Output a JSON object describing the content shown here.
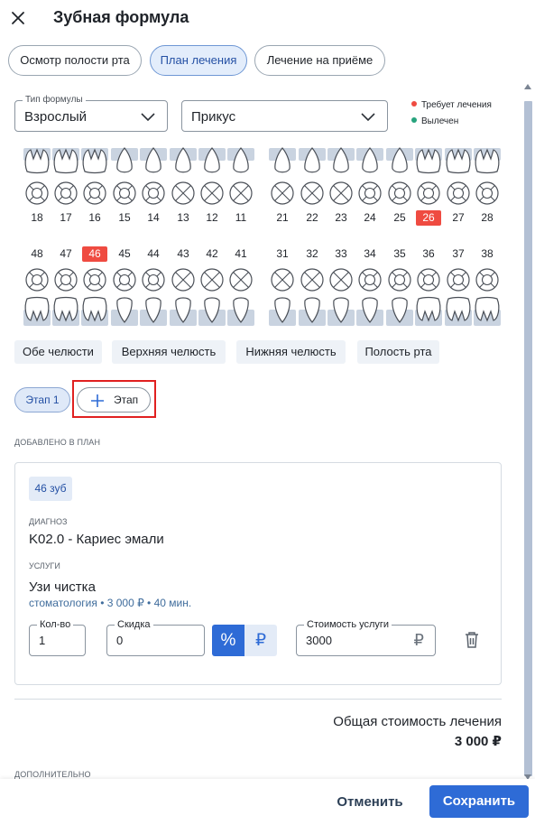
{
  "header": {
    "title": "Зубная формула"
  },
  "tabs": [
    {
      "label": "Осмотр полости рта",
      "active": false
    },
    {
      "label": "План лечения",
      "active": true
    },
    {
      "label": "Лечение на приёме",
      "active": false
    }
  ],
  "formula_type": {
    "label": "Тип формулы",
    "value": "Взрослый"
  },
  "bite": {
    "value": "Прикус"
  },
  "legend": {
    "needs_treatment": {
      "label": "Требует лечения",
      "color": "#ef4b41"
    },
    "extracted": {
      "label": "Вылечен",
      "color": "#27a37d"
    }
  },
  "upper_teeth": [
    "18",
    "17",
    "16",
    "15",
    "14",
    "13",
    "12",
    "11",
    "21",
    "22",
    "23",
    "24",
    "25",
    "26",
    "27",
    "28"
  ],
  "lower_teeth": [
    "48",
    "47",
    "46",
    "45",
    "44",
    "43",
    "42",
    "41",
    "31",
    "32",
    "33",
    "34",
    "35",
    "36",
    "37",
    "38"
  ],
  "selected_teeth": [
    "26",
    "46"
  ],
  "jaw_buttons": [
    "Обе челюсти",
    "Верхняя челюсть",
    "Нижняя челюсть",
    "Полость рта"
  ],
  "stages": {
    "current": "Этап 1",
    "add_label": "Этап"
  },
  "plan": {
    "section_caption": "ДОБАВЛЕНО В ПЛАН",
    "tooth_badge": "46 зуб",
    "diagnosis_caption": "ДИАГНОЗ",
    "diagnosis": "K02.0 - Кариес эмали",
    "services_caption": "УСЛУГИ",
    "service_name": "Узи чистка",
    "service_meta": "стоматология • 3 000 ₽ • 40 мин.",
    "qty": {
      "label": "Кол-во",
      "value": "1"
    },
    "discount": {
      "label": "Скидка",
      "value": "0"
    },
    "discount_percent_symbol": "%",
    "discount_rub_symbol": "₽",
    "cost": {
      "label": "Стоимость услуги",
      "value": "3000",
      "currency": "₽"
    }
  },
  "total": {
    "label": "Общая стоимость лечения",
    "value": "3 000 ₽"
  },
  "extra_caption": "ДОПОЛНИТЕЛЬНО",
  "footer": {
    "cancel_label": "Отменить",
    "save_label": "Сохранить"
  },
  "colors": {
    "accent": "#2e6bd6",
    "selected": "#ef4b41",
    "tooth_outline": "#4a4f57",
    "gum": "#c9d3e0"
  }
}
